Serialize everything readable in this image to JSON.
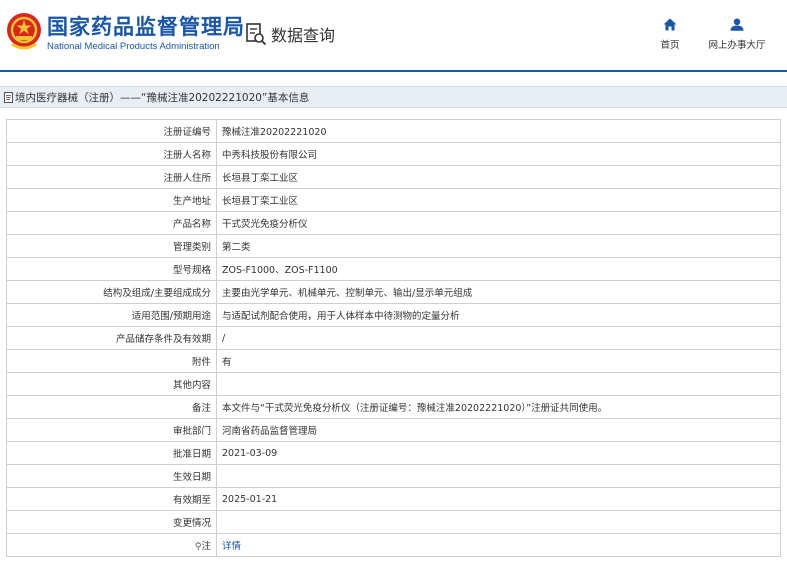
{
  "header": {
    "title_cn": "国家药品监督管理局",
    "title_en": "National Medical Products Administration",
    "query_label": "数据查询",
    "nav": [
      {
        "label": "首页",
        "icon": "home-icon"
      },
      {
        "label": "网上办事大厅",
        "icon": "user-icon"
      }
    ]
  },
  "breadcrumb": {
    "text": "境内医疗器械（注册）——“豫械注准20202221020”基本信息"
  },
  "details": {
    "rows": [
      {
        "label": "注册证编号",
        "value": "豫械注准20202221020"
      },
      {
        "label": "注册人名称",
        "value": "中秀科技股份有限公司"
      },
      {
        "label": "注册人住所",
        "value": "长垣县丁栾工业区"
      },
      {
        "label": "生产地址",
        "value": "长垣县丁栾工业区"
      },
      {
        "label": "产品名称",
        "value": "干式荧光免疫分析仪"
      },
      {
        "label": "管理类别",
        "value": "第二类"
      },
      {
        "label": "型号规格",
        "value": "ZOS-F1000、ZOS-F1100"
      },
      {
        "label": "结构及组成/主要组成成分",
        "value": "主要由光学单元、机械单元、控制单元、输出/显示单元组成"
      },
      {
        "label": "适用范围/预期用途",
        "value": "与适配试剂配合使用，用于人体样本中待测物的定量分析"
      },
      {
        "label": "产品储存条件及有效期",
        "value": "/"
      },
      {
        "label": "附件",
        "value": "有"
      },
      {
        "label": "其他内容",
        "value": ""
      },
      {
        "label": "备注",
        "value": "本文件与“干式荧光免疫分析仪（注册证编号：豫械注准20202221020）”注册证共同使用。"
      },
      {
        "label": "审批部门",
        "value": "河南省药品监督管理局"
      },
      {
        "label": "批准日期",
        "value": "2021-03-09"
      },
      {
        "label": "生效日期",
        "value": ""
      },
      {
        "label": "有效期至",
        "value": "2025-01-21"
      },
      {
        "label": "变更情况",
        "value": ""
      }
    ],
    "note_label": "注",
    "note_link": "详情"
  },
  "colors": {
    "brand_blue": "#1a56a8",
    "breadcrumb_bg": "#e9eef5",
    "emblem_red": "#d9261c",
    "emblem_gold": "#f2c230"
  }
}
